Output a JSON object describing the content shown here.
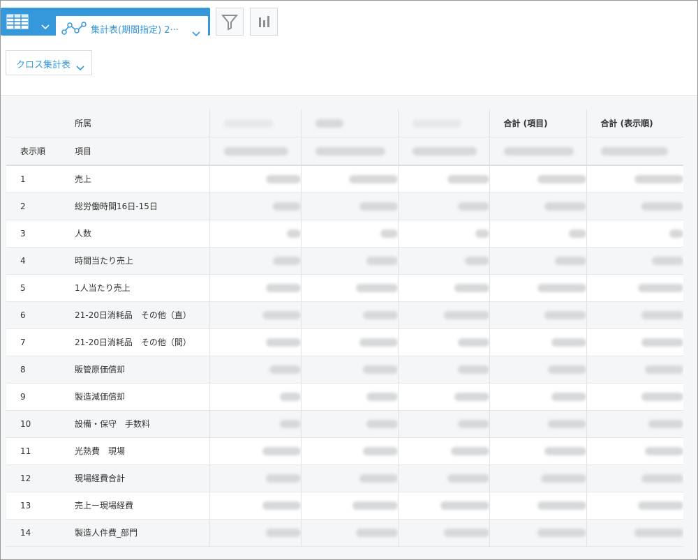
{
  "toolbar": {
    "view_name": "集計表(期間指定) 2···",
    "mode_label": "クロス集計表",
    "icons": {
      "table": "table-icon",
      "graph": "graph-icon",
      "filter": "filter-icon",
      "chart": "bar-chart-icon",
      "dropdown": "chevron-down-icon"
    },
    "accent_color": "#3498db"
  },
  "table": {
    "header1": {
      "affiliation": "所属",
      "total_item": "合計 (項目)",
      "total_order": "合計 (表示順)"
    },
    "header2": {
      "order": "表示順",
      "item": "項目"
    },
    "rows": [
      {
        "order": "1",
        "item": "売上"
      },
      {
        "order": "2",
        "item": "総労働時間16日-15日"
      },
      {
        "order": "3",
        "item": "人数"
      },
      {
        "order": "4",
        "item": "時間当たり売上"
      },
      {
        "order": "5",
        "item": "1人当たり売上"
      },
      {
        "order": "6",
        "item": "21-20日消耗品　その他（直）"
      },
      {
        "order": "7",
        "item": "21-20日消耗品　その他（間）"
      },
      {
        "order": "8",
        "item": "販管原価償却"
      },
      {
        "order": "9",
        "item": "製造減価償却"
      },
      {
        "order": "10",
        "item": "設備・保守　手数料"
      },
      {
        "order": "11",
        "item": "光熱費　現場"
      },
      {
        "order": "12",
        "item": "現場経費合計"
      },
      {
        "order": "13",
        "item": "売上ー現場経費"
      },
      {
        "order": "14",
        "item": "製造人件費_部門"
      }
    ]
  }
}
